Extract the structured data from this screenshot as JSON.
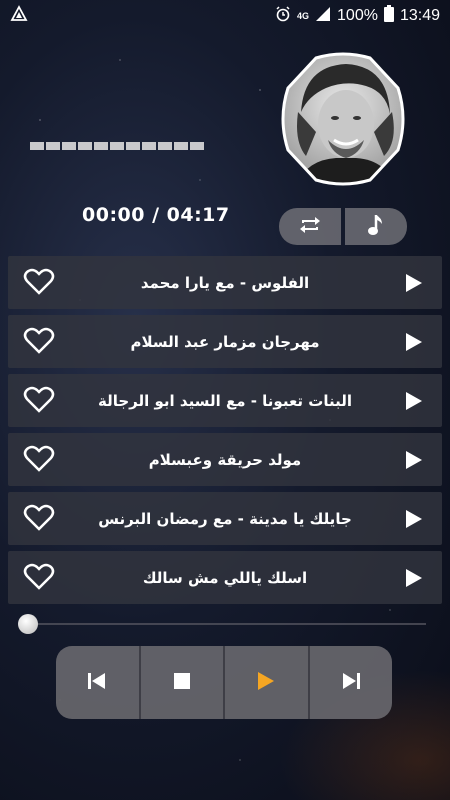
{
  "status_bar": {
    "network": "4G",
    "battery": "100%",
    "time": "13:49",
    "icons": [
      "app-notification-icon",
      "alarm-icon",
      "signal-icon",
      "battery-icon"
    ]
  },
  "player": {
    "time_display": "00:00 / 04:17",
    "progress": 0,
    "visualizer_bars": 11
  },
  "tracks": [
    {
      "title": "الفلوس - مع يارا محمد"
    },
    {
      "title": "مهرجان مزمار عبد السلام"
    },
    {
      "title": "البنات تعبونا - مع السيد ابو الرجالة"
    },
    {
      "title": "مولد حريقة وعبسلام"
    },
    {
      "title": "جايلك يا مدينة - مع رمضان البرنس"
    },
    {
      "title": "اسلك ياللي مش سالك"
    }
  ],
  "colors": {
    "accent_play": "#f5a623",
    "panel": "#32343e",
    "text": "#ffffff"
  }
}
